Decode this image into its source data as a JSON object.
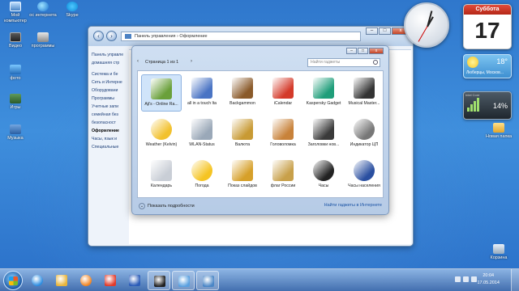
{
  "desktop": {
    "icons": [
      {
        "label": "Мой компьютер"
      },
      {
        "label": "ос интернета"
      },
      {
        "label": "Skype"
      },
      {
        "label": "Видео"
      },
      {
        "label": "программы"
      },
      {
        "label": "фото"
      },
      {
        "label": "Игры"
      },
      {
        "label": "Музыка"
      },
      {
        "label": "Новая папка"
      },
      {
        "label": "Корзина"
      }
    ]
  },
  "control_panel": {
    "address": "Панель управления › Оформление",
    "window_controls": {
      "minimize": "–",
      "maximize": "□",
      "close": "x"
    },
    "sidebar": [
      {
        "label": "Панель управле"
      },
      {
        "label": "домашняя стр"
      },
      {
        "label": "Система и бе"
      },
      {
        "label": "Сеть и Интерне"
      },
      {
        "label": "Оборудовани"
      },
      {
        "label": "Программы"
      },
      {
        "label": "Учетные запи"
      },
      {
        "label": "семейная без"
      },
      {
        "label": "безопасност"
      },
      {
        "label": "Оформление"
      },
      {
        "label": "Часы, язык и"
      },
      {
        "label": "Специальные"
      }
    ]
  },
  "gadget_gallery": {
    "page_label": "Страница 1 из 1",
    "search_placeholder": "Найти гаджеты",
    "gadgets": [
      {
        "label": "Aji's - Online Ra...",
        "icon": "radio-icon",
        "color": "#6aa03a"
      },
      {
        "label": "all in a touch lta",
        "icon": "keyboard-icon",
        "color": "#4a74c4"
      },
      {
        "label": "Backgammon",
        "icon": "backgammon-icon",
        "color": "#8a5a2a"
      },
      {
        "label": "iCalendar",
        "icon": "calendar-icon",
        "color": "#d43a2a"
      },
      {
        "label": "Kaspersky Gadget",
        "icon": "monitor-icon",
        "color": "#1f9e7a"
      },
      {
        "label": "Musical Master...",
        "icon": "piano-icon",
        "color": "#333333"
      },
      {
        "label": "Weather (Kelvin)",
        "icon": "weather-icon",
        "color": "#f2c12e"
      },
      {
        "label": "WLAN-Status",
        "icon": "wlan-icon",
        "color": "#9aa8b8"
      },
      {
        "label": "Валюта",
        "icon": "currency-icon",
        "color": "#c89a34"
      },
      {
        "label": "Головоломка",
        "icon": "puzzle-icon",
        "color": "#c8823a"
      },
      {
        "label": "Заголовки нов...",
        "icon": "news-icon",
        "color": "#3a3a3a"
      },
      {
        "label": "Индикатор ЦП",
        "icon": "cpu-icon",
        "color": "#777777"
      },
      {
        "label": "Календарь",
        "icon": "calendar-page-icon",
        "color": "#c9ced6"
      },
      {
        "label": "Погода",
        "icon": "sun-icon",
        "color": "#f5c423"
      },
      {
        "label": "Показ слайдов",
        "icon": "slideshow-icon",
        "color": "#d6a02a"
      },
      {
        "label": "флаг России",
        "icon": "flag-icon",
        "color": "#c8a04a"
      },
      {
        "label": "Часы",
        "icon": "clock-icon",
        "color": "#222222"
      },
      {
        "label": "Часы населения",
        "icon": "globe-icon",
        "color": "#2a4fa0"
      }
    ],
    "details_label": "Показать подробности",
    "online_link": "Найти гаджеты в Интернете"
  },
  "widgets": {
    "calendar": {
      "weekday": "Суббота",
      "day": "17"
    },
    "weather": {
      "temp": "18°",
      "city": "Люберцы, Москов..."
    },
    "cpu": {
      "label": "Intel Core",
      "value": "14%"
    }
  },
  "taskbar": {
    "apps": [
      {
        "name": "ie-icon",
        "color": "#2a8be0"
      },
      {
        "name": "folder-icon",
        "color": "#e8b43a"
      },
      {
        "name": "media-player-icon",
        "color": "#f0821e"
      },
      {
        "name": "yandex-icon",
        "color": "#e23a2a"
      },
      {
        "name": "word-icon",
        "color": "#2b5cb8"
      },
      {
        "name": "camera-icon",
        "color": "#202020"
      },
      {
        "name": "gadget-icon",
        "color": "#5aa0e0"
      },
      {
        "name": "control-panel-icon",
        "color": "#4a86c6"
      }
    ],
    "time": "20:04",
    "date": "17.05.2014"
  }
}
